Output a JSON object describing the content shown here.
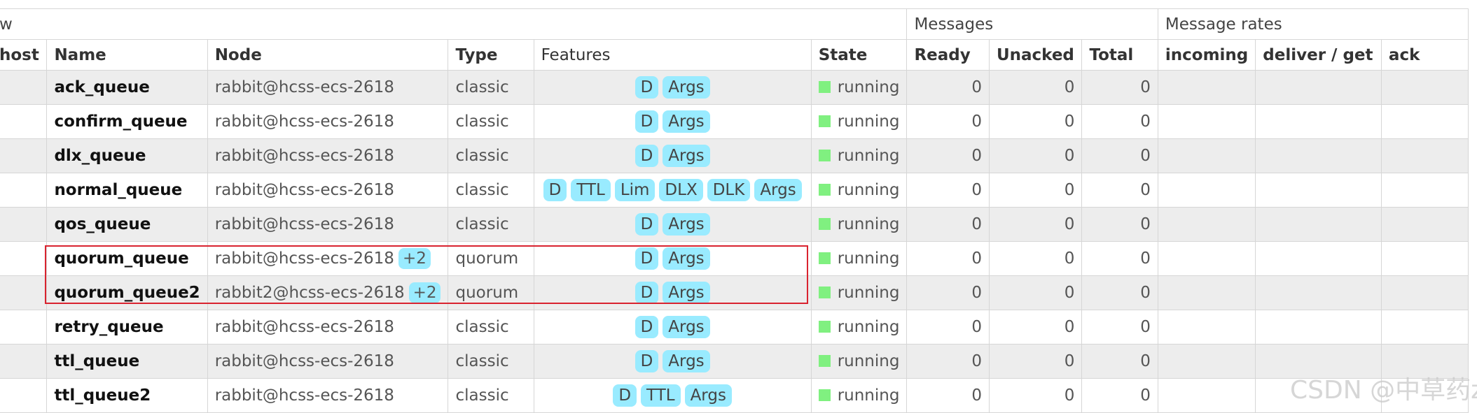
{
  "group_headers": {
    "overview": "w",
    "messages": "Messages",
    "message_rates": "Message rates"
  },
  "columns": {
    "vhost": "host",
    "name": "Name",
    "node": "Node",
    "type": "Type",
    "features": "Features",
    "state": "State",
    "ready": "Ready",
    "unacked": "Unacked",
    "total": "Total",
    "incoming": "incoming",
    "deliver_get": "deliver / get",
    "ack": "ack"
  },
  "colors": {
    "badge_bg": "#99ebff",
    "running_indicator": "#80f080",
    "highlight_border": "#d9232f"
  },
  "queues": [
    {
      "name": "ack_queue",
      "node": "rabbit@hcss-ecs-2618",
      "node_extra": "",
      "type": "classic",
      "features": [
        "D",
        "Args"
      ],
      "state": "running",
      "ready": "0",
      "unacked": "0",
      "total": "0"
    },
    {
      "name": "confirm_queue",
      "node": "rabbit@hcss-ecs-2618",
      "node_extra": "",
      "type": "classic",
      "features": [
        "D",
        "Args"
      ],
      "state": "running",
      "ready": "0",
      "unacked": "0",
      "total": "0"
    },
    {
      "name": "dlx_queue",
      "node": "rabbit@hcss-ecs-2618",
      "node_extra": "",
      "type": "classic",
      "features": [
        "D",
        "Args"
      ],
      "state": "running",
      "ready": "0",
      "unacked": "0",
      "total": "0"
    },
    {
      "name": "normal_queue",
      "node": "rabbit@hcss-ecs-2618",
      "node_extra": "",
      "type": "classic",
      "features": [
        "D",
        "TTL",
        "Lim",
        "DLX",
        "DLK",
        "Args"
      ],
      "state": "running",
      "ready": "0",
      "unacked": "0",
      "total": "0"
    },
    {
      "name": "qos_queue",
      "node": "rabbit@hcss-ecs-2618",
      "node_extra": "",
      "type": "classic",
      "features": [
        "D",
        "Args"
      ],
      "state": "running",
      "ready": "0",
      "unacked": "0",
      "total": "0"
    },
    {
      "name": "quorum_queue",
      "node": "rabbit@hcss-ecs-2618",
      "node_extra": "+2",
      "type": "quorum",
      "features": [
        "D",
        "Args"
      ],
      "state": "running",
      "ready": "0",
      "unacked": "0",
      "total": "0"
    },
    {
      "name": "quorum_queue2",
      "node": "rabbit2@hcss-ecs-2618",
      "node_extra": "+2",
      "type": "quorum",
      "features": [
        "D",
        "Args"
      ],
      "state": "running",
      "ready": "0",
      "unacked": "0",
      "total": "0"
    },
    {
      "name": "retry_queue",
      "node": "rabbit@hcss-ecs-2618",
      "node_extra": "",
      "type": "classic",
      "features": [
        "D",
        "Args"
      ],
      "state": "running",
      "ready": "0",
      "unacked": "0",
      "total": "0"
    },
    {
      "name": "ttl_queue",
      "node": "rabbit@hcss-ecs-2618",
      "node_extra": "",
      "type": "classic",
      "features": [
        "D",
        "Args"
      ],
      "state": "running",
      "ready": "0",
      "unacked": "0",
      "total": "0"
    },
    {
      "name": "ttl_queue2",
      "node": "rabbit@hcss-ecs-2618",
      "node_extra": "",
      "type": "classic",
      "features": [
        "D",
        "TTL",
        "Args"
      ],
      "state": "running",
      "ready": "0",
      "unacked": "0",
      "total": "0"
    }
  ],
  "watermark": "CSDN @中草药z"
}
